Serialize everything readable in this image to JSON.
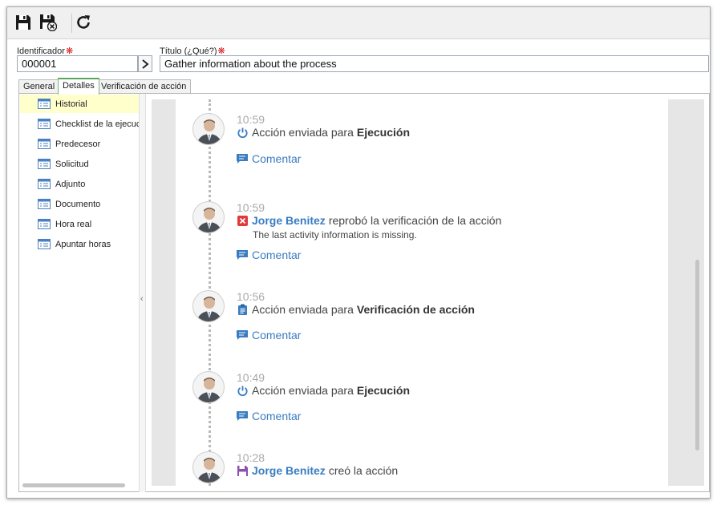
{
  "toolbar": {
    "buttons": [
      {
        "name": "save-button",
        "icon": "floppy-disk-icon"
      },
      {
        "name": "save-close-button",
        "icon": "floppy-disk-close-icon"
      },
      {
        "name": "refresh-button",
        "icon": "refresh-icon"
      }
    ]
  },
  "form": {
    "id_label": "Identificador",
    "id_value": "000001",
    "title_label": "Título (¿Qué?)",
    "title_value": "Gather information about the process",
    "required_marker": "❋"
  },
  "tabs": [
    {
      "label": "General",
      "active": false
    },
    {
      "label": "Detalles",
      "active": true
    },
    {
      "label": "Verificación de acción",
      "active": false
    }
  ],
  "sidebar": {
    "items": [
      {
        "label": "Historial",
        "active": true
      },
      {
        "label": "Checklist de la ejecuc",
        "active": false
      },
      {
        "label": "Predecesor",
        "active": false
      },
      {
        "label": "Solicitud",
        "active": false
      },
      {
        "label": "Adjunto",
        "active": false
      },
      {
        "label": "Documento",
        "active": false
      },
      {
        "label": "Hora real",
        "active": false
      },
      {
        "label": "Apuntar horas",
        "active": false
      }
    ]
  },
  "history": {
    "comment_label": "Comentar",
    "entries": [
      {
        "time": "10:59",
        "icon": "power-icon",
        "user": "",
        "text": "Acción enviada para",
        "strong": "Ejecución",
        "note": ""
      },
      {
        "time": "10:59",
        "icon": "reject-x-icon",
        "user": "Jorge Benitez",
        "text": "reprobó la verificación de la acción",
        "strong": "",
        "note": "The last activity information is missing."
      },
      {
        "time": "10:56",
        "icon": "clipboard-icon",
        "user": "",
        "text": "Acción enviada para",
        "strong": "Verificación de acción",
        "note": ""
      },
      {
        "time": "10:49",
        "icon": "power-icon",
        "user": "",
        "text": "Acción enviada para",
        "strong": "Ejecución",
        "note": ""
      },
      {
        "time": "10:28",
        "icon": "floppy-disk-icon",
        "user": "Jorge Benitez",
        "text": "creó la acción",
        "strong": "",
        "note": ""
      }
    ]
  },
  "colors": {
    "link": "#3a7cc1",
    "active_sidebar": "#ffffcc",
    "reject": "#e03a3a",
    "created": "#8e4fb3",
    "required": "#dd1111"
  }
}
